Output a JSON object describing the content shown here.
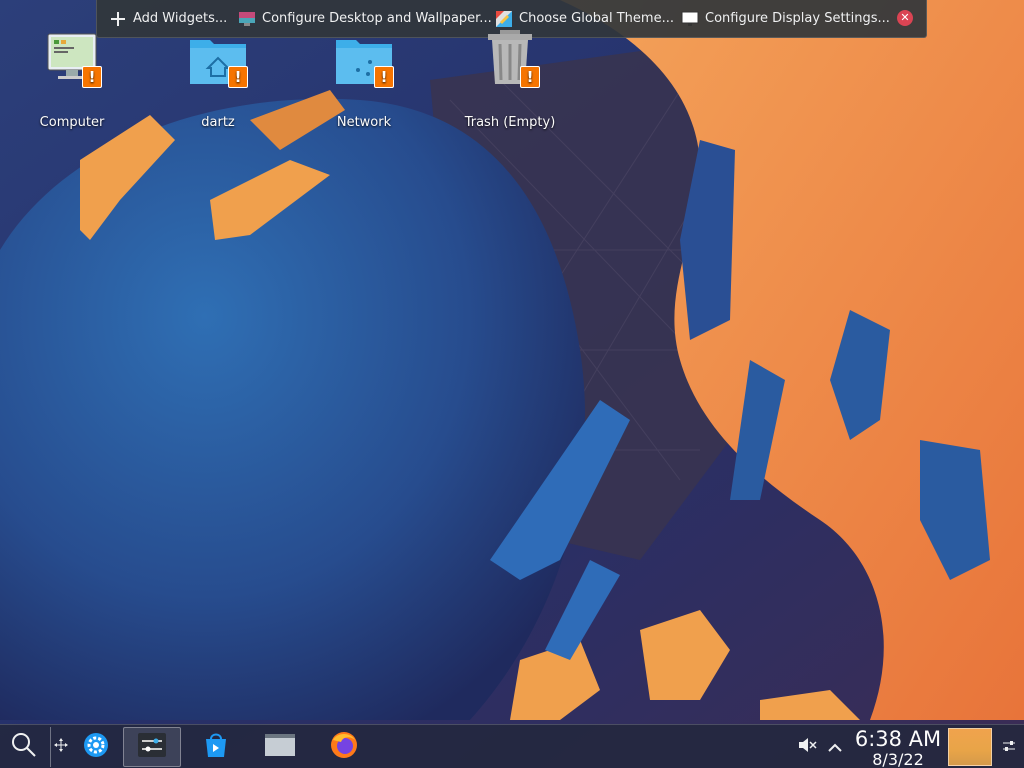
{
  "toolbox": {
    "add_widgets": "Add Widgets...",
    "configure_desktop": "Configure Desktop and Wallpaper...",
    "global_theme": "Choose Global Theme...",
    "display_settings": "Configure Display Settings..."
  },
  "desktop": {
    "icons": [
      {
        "label": "Computer",
        "icon": "computer-icon"
      },
      {
        "label": "dartz",
        "icon": "home-folder-icon"
      },
      {
        "label": "Network",
        "icon": "network-folder-icon"
      },
      {
        "label": "Trash (Empty)",
        "icon": "trash-icon"
      }
    ],
    "warning_badge": "!"
  },
  "taskbar": {
    "clock_time": "6:38 AM",
    "clock_date": "8/3/22"
  },
  "colors": {
    "accent_orange": "#f67400",
    "close_red": "#da4453",
    "folder_blue": "#3daee9",
    "wallpaper_orange": "#f0944a",
    "wallpaper_blue": "#2b5fa8"
  }
}
